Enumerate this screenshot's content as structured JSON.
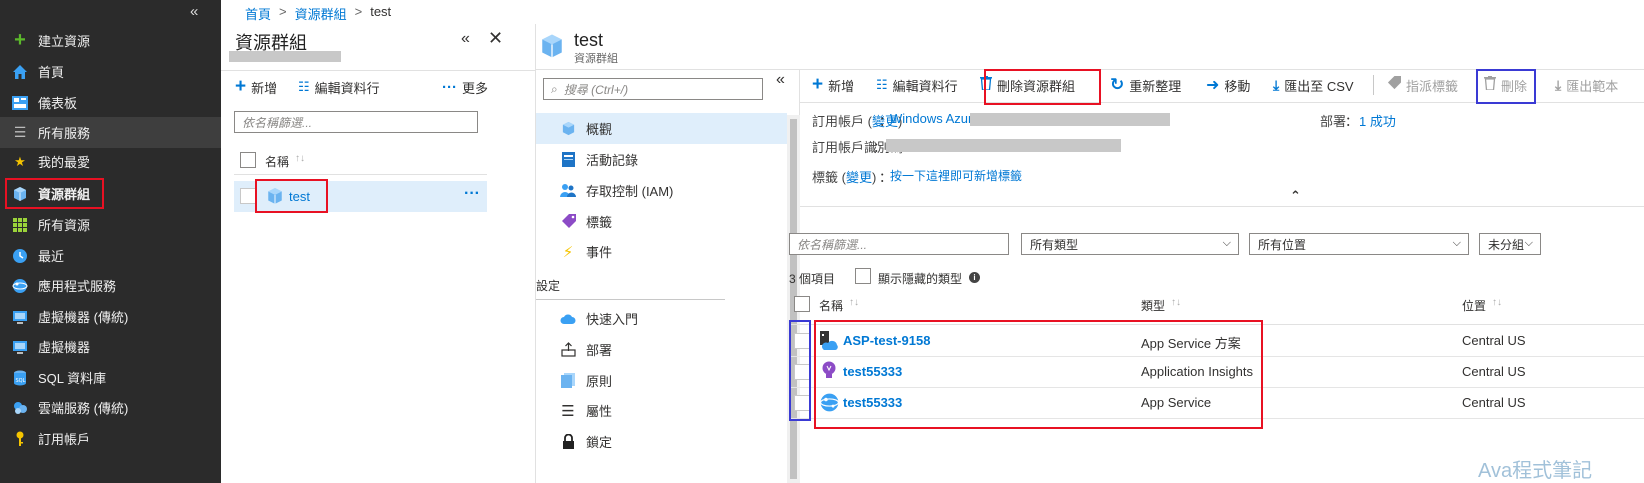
{
  "breadcrumb": {
    "home": "首頁",
    "sep1": ">",
    "resource_groups": "資源群組",
    "sep2": ">",
    "current": "test"
  },
  "leftnav": {
    "collapse": "«",
    "items": [
      {
        "label": "建立資源",
        "icon": "plus-icon"
      },
      {
        "label": "首頁",
        "icon": "home-icon"
      },
      {
        "label": "儀表板",
        "icon": "dashboard-icon"
      },
      {
        "label": "所有服務",
        "icon": "list-icon"
      },
      {
        "label": "我的最愛",
        "icon": "star-icon"
      },
      {
        "label": "資源群組",
        "icon": "resource-group-icon"
      },
      {
        "label": "所有資源",
        "icon": "grid-icon"
      },
      {
        "label": "最近",
        "icon": "clock-icon"
      },
      {
        "label": "應用程式服務",
        "icon": "app-service-icon"
      },
      {
        "label": "虛擬機器 (傳統)",
        "icon": "vm-classic-icon"
      },
      {
        "label": "虛擬機器",
        "icon": "vm-icon"
      },
      {
        "label": "SQL 資料庫",
        "icon": "sql-icon"
      },
      {
        "label": "雲端服務 (傳統)",
        "icon": "cloud-service-icon"
      },
      {
        "label": "訂用帳戶",
        "icon": "key-icon"
      }
    ]
  },
  "rg_panel": {
    "title": "資源群組",
    "pin": "«",
    "close": "✕",
    "toolbar": {
      "add": "新增",
      "edit_columns": "編輯資料行",
      "more": "更多"
    },
    "filter_placeholder": "依名稱篩選...",
    "column_name": "名稱",
    "sort": "↑↓",
    "row_name": "test",
    "row_more": "···"
  },
  "header": {
    "title": "test",
    "subtitle": "資源群組"
  },
  "menu": {
    "search_placeholder": "搜尋 (Ctrl+/)",
    "collapse": "«",
    "items": [
      {
        "label": "概觀",
        "icon": "cube-icon"
      },
      {
        "label": "活動記錄",
        "icon": "log-icon"
      },
      {
        "label": "存取控制 (IAM)",
        "icon": "people-icon"
      },
      {
        "label": "標籤",
        "icon": "tag-icon"
      },
      {
        "label": "事件",
        "icon": "lightning-icon"
      }
    ],
    "settings_header": "設定",
    "settings_items": [
      {
        "label": "快速入門",
        "icon": "cloud-icon"
      },
      {
        "label": "部署",
        "icon": "deploy-icon"
      },
      {
        "label": "原則",
        "icon": "policy-icon"
      },
      {
        "label": "屬性",
        "icon": "properties-icon"
      },
      {
        "label": "鎖定",
        "icon": "lock-icon"
      }
    ]
  },
  "toolbar": {
    "add": "新增",
    "edit_columns": "編輯資料行",
    "delete_rg": "刪除資源群組",
    "refresh": "重新整理",
    "move": "移動",
    "export_csv": "匯出至 CSV",
    "assign_tags": "指派標籤",
    "delete": "刪除",
    "export_template": "匯出範本"
  },
  "essentials": {
    "subscription_label": "訂用帳戶 (",
    "change": "變更",
    "subscription_label_end": ")",
    "colon": "：",
    "subscription_value": "Windows Azure",
    "subscription_id_label": "訂用帳戶識別碼",
    "subscription_id_colon": "：",
    "deployments_label": "部署",
    "deployments_colon": "：",
    "deployments_value": "1 成功",
    "tags_label": "標籤 (",
    "tags_change": "變更",
    "tags_label_end": ")",
    "tags_colon": "：",
    "tags_value": "按一下這裡即可新增標籤",
    "collapse": "⌃"
  },
  "filters": {
    "name_placeholder": "依名稱篩選...",
    "type_value": "所有類型",
    "location_value": "所有位置",
    "group_value": "未分組"
  },
  "count_text": "3 個項目",
  "show_hidden": "顯示隱藏的類型",
  "info": "i",
  "columns": {
    "name": "名稱",
    "type": "類型",
    "location": "位置",
    "sort": "↑↓"
  },
  "resources": [
    {
      "name": "ASP-test-9158",
      "type": "App Service 方案",
      "location": "Central US",
      "icon": "app-service-plan-icon"
    },
    {
      "name": "test55333",
      "type": "Application Insights",
      "location": "Central US",
      "icon": "lightbulb-icon"
    },
    {
      "name": "test55333",
      "type": "App Service",
      "location": "Central US",
      "icon": "globe-icon"
    }
  ],
  "watermark": "Ava程式筆記",
  "colors": {
    "accent": "#0078d4",
    "nav_bg": "#2b2b2b",
    "highlight_red": "#e81123",
    "highlight_blue": "#3a3ad4"
  }
}
